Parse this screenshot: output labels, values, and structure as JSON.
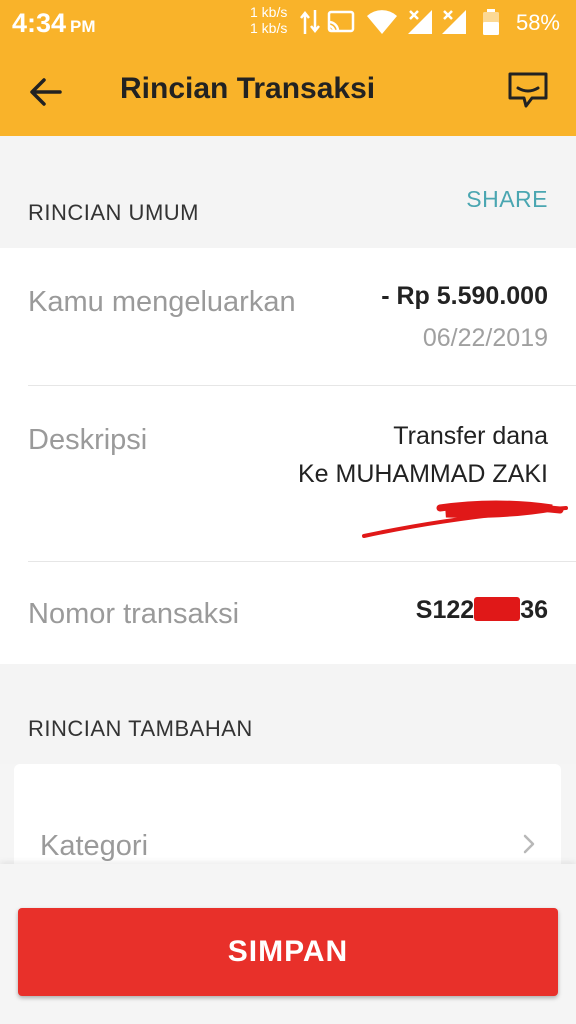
{
  "status_bar": {
    "time": "4:34",
    "ampm": "PM",
    "net_up": "1 kb/s",
    "net_down": "1 kb/s",
    "battery": "58%"
  },
  "app_bar": {
    "title": "Rincian Transaksi"
  },
  "general": {
    "section_title": "RINCIAN UMUM",
    "share_label": "SHARE",
    "spent_label": "Kamu mengeluarkan",
    "amount": "- Rp 5.590.000",
    "date": "06/22/2019",
    "description_label": "Deskripsi",
    "description_line1": "Transfer dana",
    "description_line2": "Ke MUHAMMAD ZAKI",
    "transaction_label": "Nomor transaksi",
    "transaction_prefix": "S122",
    "transaction_suffix": "36"
  },
  "extra": {
    "section_title": "RINCIAN TAMBAHAN",
    "category_label": "Kategori"
  },
  "footer": {
    "save_label": "SIMPAN"
  },
  "colors": {
    "accent": "#f9b32a",
    "primary_button": "#e8302a",
    "link": "#4aa6b1"
  }
}
